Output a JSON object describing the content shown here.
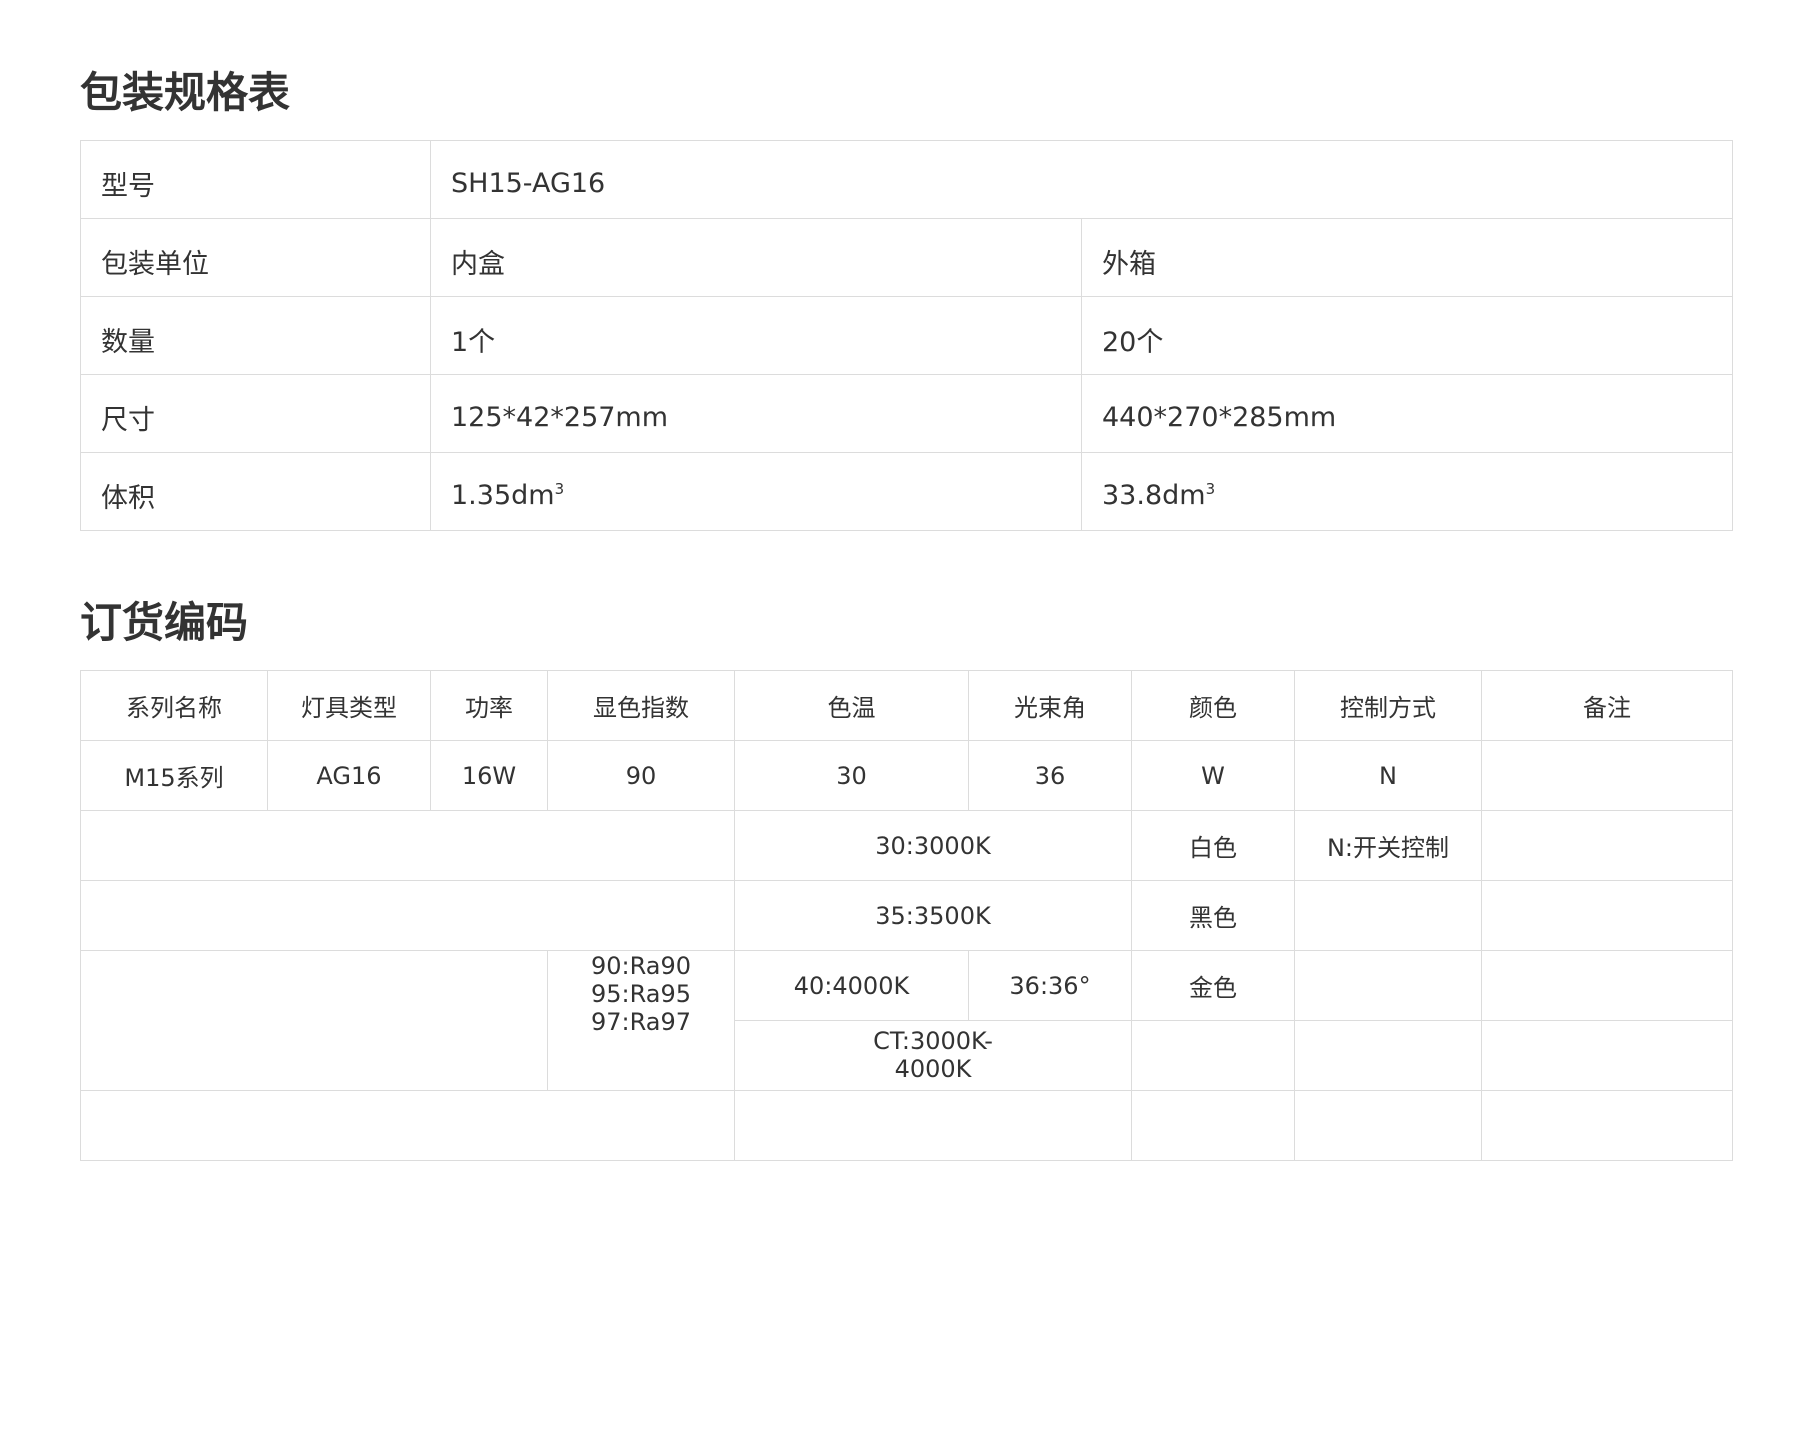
{
  "packaging": {
    "title": "包装规格表",
    "model_label": "型号",
    "model_value": "SH15-AG16",
    "rows": [
      {
        "label": "包装单位",
        "inner": "内盒",
        "outer": "外箱"
      },
      {
        "label": "数量",
        "inner": "1个",
        "outer": "20个"
      },
      {
        "label": "尺寸",
        "inner": "125*42*257mm",
        "outer": "440*270*285mm"
      }
    ],
    "volume": {
      "label": "体积",
      "inner": "1.35dm",
      "outer": "33.8dm",
      "unit_sup": "3"
    }
  },
  "ordering": {
    "title": "订货编码",
    "headers": [
      "系列名称",
      "灯具类型",
      "功率",
      "显色指数",
      "色温",
      "光束角",
      "颜色",
      "控制方式",
      "备注"
    ],
    "code_row": [
      "M15系列",
      "AG16",
      "16W",
      "90",
      "30",
      "36",
      "W",
      "N",
      ""
    ],
    "options": {
      "cri": [
        "90:Ra90",
        "95:Ra95",
        "97:Ra97"
      ],
      "cct": [
        "30:3000K",
        "35:3500K",
        "40:4000K",
        "CT:3000K-",
        "4000K"
      ],
      "beam": "36:36°",
      "colors": [
        "白色",
        "黑色",
        "金色"
      ],
      "control": "N:开关控制"
    }
  }
}
